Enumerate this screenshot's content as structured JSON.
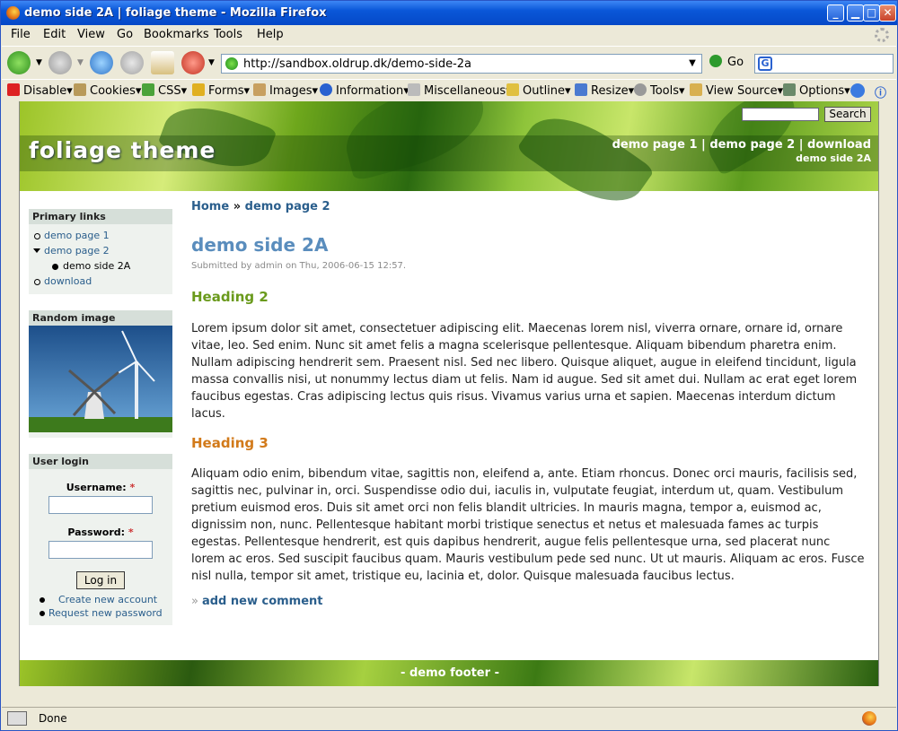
{
  "window": {
    "title": "demo side 2A | foliage theme - Mozilla Firefox"
  },
  "menubar": {
    "items": [
      "File",
      "Edit",
      "View",
      "Go",
      "Bookmarks",
      "Tools",
      "Help"
    ]
  },
  "navbar": {
    "url": "http://sandbox.oldrup.dk/demo-side-2a",
    "go_label": "Go",
    "search_engine": "G"
  },
  "devbar": {
    "items": [
      "Disable▾",
      "Cookies▾",
      "CSS▾",
      "Forms▾",
      "Images▾",
      "Information▾",
      "Miscellaneous▾",
      "Outline▾",
      "Resize▾",
      "Tools▾",
      "View Source▾",
      "Options▾"
    ]
  },
  "site": {
    "name": "foliage theme",
    "search_button": "Search",
    "primary_links": [
      "demo page 1",
      "|",
      "demo page 2",
      "|",
      "download"
    ],
    "secondary_link": "demo side 2A",
    "footer": "- demo footer -"
  },
  "sidebar": {
    "primary": {
      "title": "Primary links",
      "items": [
        "demo page 1",
        "demo page 2",
        "demo side 2A",
        "download"
      ]
    },
    "random_image": {
      "title": "Random image"
    },
    "login": {
      "title": "User login",
      "username_label": "Username:",
      "password_label": "Password:",
      "required_mark": "*",
      "button": "Log in",
      "links": [
        "Create new account",
        "Request new password"
      ]
    }
  },
  "main": {
    "breadcrumb": [
      "Home",
      "»",
      "demo page 2"
    ],
    "title": "demo side 2A",
    "submitted": "Submitted by admin on Thu, 2006-06-15 12:57.",
    "heading2": "Heading 2",
    "paragraph1": "Lorem ipsum dolor sit amet, consectetuer adipiscing elit. Maecenas lorem nisl, viverra ornare, ornare id, ornare vitae, leo. Sed enim. Nunc sit amet felis a magna scelerisque pellentesque. Aliquam bibendum pharetra enim. Nullam adipiscing hendrerit sem. Praesent nisl. Sed nec libero. Quisque aliquet, augue in eleifend tincidunt, ligula massa convallis nisi, ut nonummy lectus diam ut felis. Nam id augue. Sed sit amet dui. Nullam ac erat eget lorem faucibus egestas. Cras adipiscing lectus quis risus. Vivamus varius urna et sapien. Maecenas interdum dictum lacus.",
    "heading3": "Heading 3",
    "paragraph2": "Aliquam odio enim, bibendum vitae, sagittis non, eleifend a, ante. Etiam rhoncus. Donec orci mauris, facilisis sed, sagittis nec, pulvinar in, orci. Suspendisse odio dui, iaculis in, vulputate feugiat, interdum ut, quam. Vestibulum pretium euismod eros. Duis sit amet orci non felis blandit ultricies. In mauris magna, tempor a, euismod ac, dignissim non, nunc. Pellentesque habitant morbi tristique senectus et netus et malesuada fames ac turpis egestas. Pellentesque hendrerit, est quis dapibus hendrerit, augue felis pellentesque urna, sed placerat nunc lorem ac eros. Sed suscipit faucibus quam. Mauris vestibulum pede sed nunc. Ut ut mauris. Aliquam ac eros. Fusce nisl nulla, tempor sit amet, tristique eu, lacinia et, dolor. Quisque malesuada faucibus lectus.",
    "add_comment_marker": "»",
    "add_comment": "add new comment"
  },
  "status": {
    "text": "Done"
  },
  "colors": {
    "link": "#2a5e8c",
    "title": "#5a8dbd",
    "heading2": "#6a9a1c",
    "heading3": "#d27a1a",
    "titlebar": "#0a57d8"
  }
}
